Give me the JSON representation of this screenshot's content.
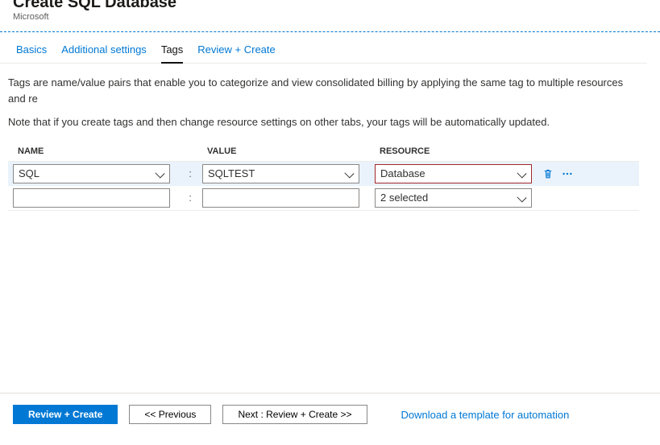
{
  "header": {
    "title": "Create SQL Database",
    "subtitle": "Microsoft"
  },
  "tabs": {
    "items": [
      {
        "label": "Basics"
      },
      {
        "label": "Additional settings"
      },
      {
        "label": "Tags"
      },
      {
        "label": "Review + Create"
      }
    ],
    "activeIndex": 2
  },
  "desc": {
    "p1": "Tags are name/value pairs that enable you to categorize and view consolidated billing by applying the same tag to multiple resources and re",
    "p2": "Note that if you create tags and then change resource settings on other tabs, your tags will be automatically updated."
  },
  "columns": {
    "name": "NAME",
    "value": "VALUE",
    "resource": "RESOURCE"
  },
  "rows": [
    {
      "name": "SQL",
      "sep": ":",
      "value": "SQLTEST",
      "resource": "Database",
      "actions": true,
      "resActive": true
    },
    {
      "name": "",
      "sep": ":",
      "value": "",
      "resource": "2 selected",
      "actions": false,
      "resActive": false
    }
  ],
  "footer": {
    "primary": "Review + Create",
    "prev": "<<  Previous",
    "next": "Next : Review + Create  >>",
    "link": "Download a template for automation"
  }
}
